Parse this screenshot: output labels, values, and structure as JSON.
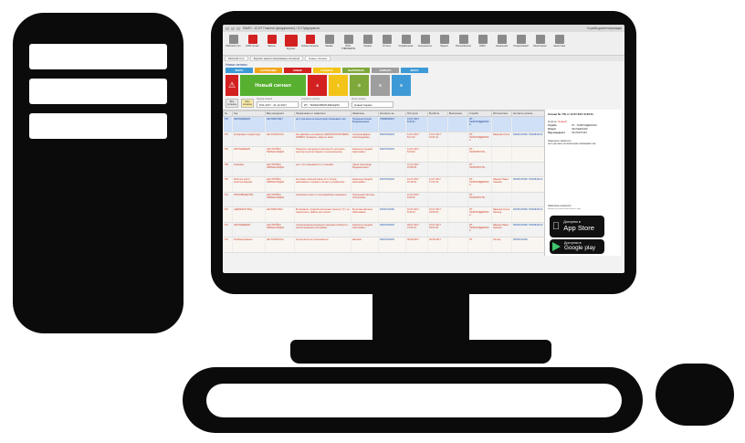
{
  "window": {
    "title": "ПАМП - 1С:ИТ Планета (предприятие) / 1С:Предприятие",
    "right_info": "Служба диспетчеризации"
  },
  "ribbon": {
    "items": [
      {
        "label": "Рабочий стол",
        "icon": "desktop-icon",
        "color": "gray"
      },
      {
        "label": "НОВ сигнал",
        "icon": "new-signal-icon",
        "color": "red"
      },
      {
        "label": "Звонок",
        "icon": "new-badge-icon",
        "color": "red"
      },
      {
        "label": "Журнал",
        "icon": "journal-icon",
        "color": "red"
      },
      {
        "label": "Новые сигналы",
        "icon": "alert-icon",
        "color": "red"
      },
      {
        "label": "Заявки",
        "icon": "requests-icon",
        "color": "gray"
      },
      {
        "label": "ПРО-ТИВОМЕРЫ",
        "icon": "measures-icon",
        "color": "gray"
      },
      {
        "label": "Сводка",
        "icon": "summary-icon",
        "color": "gray"
      },
      {
        "label": "Отчеты",
        "icon": "reports-icon",
        "color": "gray"
      },
      {
        "label": "Справочники",
        "icon": "catalogs-icon",
        "color": "gray"
      },
      {
        "label": "Контрагенты",
        "icon": "contractors-icon",
        "color": "gray"
      },
      {
        "label": "Задачи",
        "icon": "tasks-icon",
        "color": "gray"
      },
      {
        "label": "Пользователи",
        "icon": "users-icon",
        "color": "gray"
      },
      {
        "label": "ОРКС",
        "icon": "orks-icon",
        "color": "gray"
      },
      {
        "label": "Начальник",
        "icon": "chief-icon",
        "color": "gray"
      },
      {
        "label": "Оперативный",
        "icon": "operative-icon",
        "color": "gray"
      },
      {
        "label": "Мониторинг",
        "icon": "monitoring-icon",
        "color": "gray"
      },
      {
        "label": "Аналитика",
        "icon": "analytics-icon",
        "color": "gray"
      }
    ]
  },
  "tabs": [
    {
      "label": "Рабочий стол",
      "active": false
    },
    {
      "label": "Журнал зарегистрированных сигналов",
      "active": false
    },
    {
      "label": "Новые сигналы",
      "active": true
    }
  ],
  "section_title": "Новые сигналы",
  "status_tabs": [
    {
      "label": "ВСЕГО",
      "color": "#3d9ad6"
    },
    {
      "label": "НАСТОЯ-ЩЕЕ",
      "color": "#f2a51a"
    },
    {
      "label": "НОВЫЕ",
      "color": "#d32020"
    },
    {
      "label": "В РАБОТЕ",
      "color": "#f3c317"
    },
    {
      "label": "ВЫПОЛНЕНО",
      "color": "#7fa83a"
    },
    {
      "label": "ЗАКРЫТО",
      "color": "#9e9e9e"
    },
    {
      "label": "ВСЕГО",
      "color": "#3d9ad6"
    }
  ],
  "new_signal_label": "Новый сигнал",
  "counters": [
    {
      "value": "4",
      "color": "#d32020"
    },
    {
      "value": "1",
      "color": "#f3c317"
    },
    {
      "value": "0",
      "color": "#7fa83a"
    },
    {
      "value": "0",
      "color": "#9e9e9e"
    },
    {
      "value": "5",
      "color": "#3d9ad6"
    }
  ],
  "filters": {
    "btn_all": "Все сигналы",
    "btn_mine": "Мои сигналы",
    "period_label": "Период сигнала",
    "period_value": "8.01.2017 - 31.12.2017",
    "service_label": "Служба по сигналу",
    "service_value": "ИТ - ТЕЛЕКОММУНИКАЦИИ",
    "author_label": "Автор сигнала",
    "author_value": "Новый Сервис"
  },
  "table": {
    "columns": [
      "№",
      "Где",
      "Вид инцидента",
      "Примечание от заявителя",
      "Заявитель",
      "Контакты за...",
      "Поступил",
      "В работе",
      "Выполнено",
      "Служба",
      "Исполнитель",
      "Контакты исполн..."
    ],
    "rows": [
      [
        "778",
        "ЭКСПЕДИЦИЯ",
        "НЕ РАБОТАЕТ",
        "на 3 уже весы не мониторим показывают нас",
        "Гордеенко Елена Владимировна",
        "79099849913",
        "12.07.2017 8:30:51",
        "",
        "",
        "ИТ - ТЕЛЕПОДДЕРЖКА",
        "",
        ""
      ],
      [
        "776",
        "Копировка и корректура",
        "НЕ ХОТЕЛОСЬ",
        "Не нажимать на клавишу ЗАРЕГИСТРИРОВАТЬ ЗАЯВКУ, проверить закрыть связь",
        "Склярова Дарья Александровна",
        "89097849939",
        "12.07.2017 8:11:42",
        "12.07.2017 10:01:12",
        "",
        "ИТ - ТЕЛЕПОДДЕРЖКА",
        "Иванова Ольга",
        "89095418480 79099849913"
      ],
      [
        "769",
        "ЭКСПЕДИЦИЯ",
        "НАСТРОЙКА ПЕРЕНАЛАДКА",
        "Поменять картридж в принтере 8, настроить принтер на регистрацию и на выполнение",
        "Ковальчук Андрей Николаевич",
        "89097849939",
        "12.07.2017 8:23:02",
        "",
        "",
        "ИТ - ТЕЛЕПРОГРА...",
        "",
        ""
      ],
      [
        "758",
        "Упаковка",
        "НАСТРОЙКА ПЕРЕНАЛАДКА",
        "на кт 10 отказывается от упаковки",
        "Чаков Александр Владимирович",
        "",
        "11.07.2017 22:58:29",
        "",
        "",
        "ИТ - ТЕЛЕПРОГРА...",
        "",
        ""
      ],
      [
        "750",
        "Рабочее место комплектовщика",
        "НАСТРОЙКА ПЕРЕНАЛАДКА",
        "Не может комплектовать (С.Х. Илья), невозможно отправить сигнал в управление",
        "Ковальчук Андрей Николаевич",
        "89097849939",
        "11.07.2017 15:18:13",
        "11.07.2017 17:01:40",
        "",
        "ИТ - ТЕЛЕПОДДЕРЖКА",
        "Иванов Павел Львович",
        "89095418480 79099849913"
      ],
      [
        "721",
        "ПРОИЗВОДСТВО",
        "НАСТРОЙКА ПЕРЕНАЛАДКА",
        "проблема печати по интерфейсам терминала",
        "Григорьева Татьяна Алексеевна",
        "",
        "11.07.2017 8:30:01",
        "",
        "",
        "ИТ - ТЕЛЕПРОГРА...",
        "",
        ""
      ],
      [
        "716",
        "АДМИНИСТРАЦ...",
        "НЕ РАБОТАЕТ",
        "В компании: Алексей Антоненко принтер: Тут. не подключено, файлы при печати",
        "Булатова Наталья Николаевна",
        "89095418480",
        "10.07.2017 8:43:23",
        "10.07.2017 19:05:02",
        "",
        "ИТ - ТЕЛЕПОДДЕРЖКА",
        "Иванова Ольга Леонид...",
        "89095418480 79099849913"
      ],
      [
        "713",
        "ЭКСПЕДИЦИЯ",
        "НАСТРОЙКА ПЕРЕНАЛАДКА",
        "Синхронизация входящего документооборота с использованием программы",
        "Ковальчук Андрей Николаевич",
        "89097849939",
        "09.07.2017 21:33:12",
        "07.07.2017 18:02:46",
        "",
        "ИТ - ТЕЛЕПОДДЕРЖКА",
        "Иванов Павел Львович",
        "89095418480 79099849913"
      ],
      [
        "701",
        "Комбинирование",
        "НЕ ХОТЕЛОСЬ",
        "Лучше всего не пользоваться",
        "Шишкин",
        "89097849939",
        "06.08.2017",
        "06.08.2017",
        "",
        "ИТ",
        "Гончар",
        "89095418480"
      ]
    ]
  },
  "details": {
    "title": "Сигнал № 778 от 12.07.2017 8:30:51",
    "status_label": "Статус:",
    "status_value": "Новый",
    "fields": [
      {
        "k": "Служба",
        "v": "ИТ - ТЕЛЕПОДДЕРЖКА"
      },
      {
        "k": "Объект",
        "v": "ЭКСПЕДИЦИЯ"
      },
      {
        "k": "Вид инцидента",
        "v": "НЕ РАБОТАЕТ"
      }
    ],
    "note_label": "Замечание заявителя",
    "note_value": "на 3 уже весы не мониторим показывают нас",
    "comment_label": "Замечание дежурного",
    "comment_hint": "Вводить до изменения рабочего кода"
  },
  "stores": {
    "apple_small": "Доступно в",
    "apple_big": "App Store",
    "google_small": "Доступно в",
    "google_big": "Google play"
  }
}
